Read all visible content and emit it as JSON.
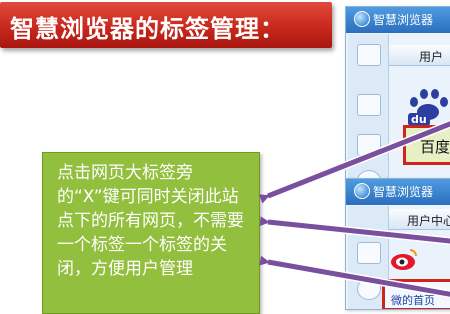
{
  "banner": {
    "title": "智慧浏览器的标签管理："
  },
  "note": {
    "text": "点击网页大标签旁的“X”键可同时关闭此站点下的所有网页，不需要一个标签一个标签的关闭，方便用户管理"
  },
  "window1": {
    "title": "智慧浏览器",
    "tab_label": "用户",
    "paw_label": "du",
    "highlight_label": "百度"
  },
  "window2": {
    "title": "智慧浏览器",
    "tab_label": "用户中心",
    "highlight_label": "微的首页"
  },
  "colors": {
    "banner_red": "#c9281d",
    "note_green": "#92bf3e",
    "arrow_purple": "#7a4f9e",
    "highlight_red": "#d0241b"
  }
}
